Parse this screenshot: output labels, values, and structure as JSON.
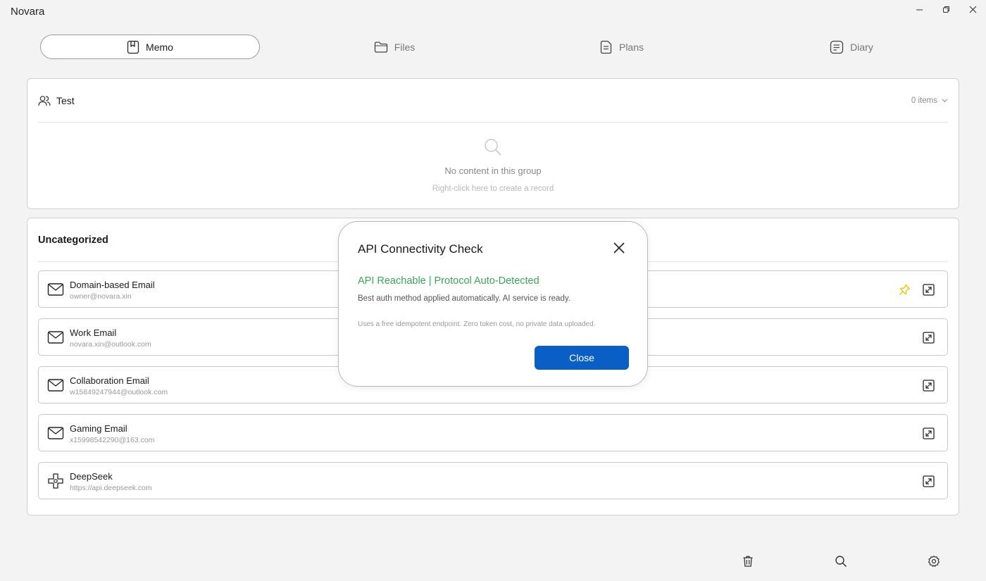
{
  "app": {
    "title": "Novara"
  },
  "window_controls": [
    "minimize-icon",
    "restore-icon",
    "close-icon"
  ],
  "tabs": [
    {
      "label": "Memo",
      "icon": "bookmark-icon",
      "active": true
    },
    {
      "label": "Files",
      "icon": "folder-icon",
      "active": false
    },
    {
      "label": "Plans",
      "icon": "document-icon",
      "active": false
    },
    {
      "label": "Diary",
      "icon": "notebook-icon",
      "active": false
    }
  ],
  "group_test": {
    "title": "Test",
    "icon": "people-icon",
    "count": "0 items",
    "empty_message": "No content in this group",
    "empty_hint": "Right-click here to create a record"
  },
  "group_uncategorized": {
    "title": "Uncategorized",
    "items": [
      {
        "name": "Domain-based Email",
        "sub": "owner@novara.xin",
        "icon": "mail-icon",
        "pinned": true
      },
      {
        "name": "Work Email",
        "sub": "novara.xin@outlook.com",
        "icon": "mail-icon",
        "pinned": false
      },
      {
        "name": "Collaboration Email",
        "sub": "w15849247944@outlook.com",
        "icon": "mail-icon",
        "pinned": false
      },
      {
        "name": "Gaming Email",
        "sub": "x15998542290@163.com",
        "icon": "mail-icon",
        "pinned": false
      },
      {
        "name": "DeepSeek",
        "sub": "https://api.deepseek.com",
        "icon": "api-icon",
        "pinned": false
      }
    ]
  },
  "toolbar": [
    "trash-icon",
    "search-icon",
    "settings-icon"
  ],
  "dialog": {
    "title": "API Connectivity Check",
    "status": "API Reachable | Protocol Auto-Detected",
    "description": "Best auth method applied automatically. AI service is ready.",
    "note": "Uses a free idempotent endpoint. Zero token cost, no private data uploaded.",
    "close_label": "Close"
  },
  "colors": {
    "accent": "#0a5fc6",
    "success": "#3aa655",
    "pin": "#f2c200",
    "background": "#f3f3f3"
  }
}
